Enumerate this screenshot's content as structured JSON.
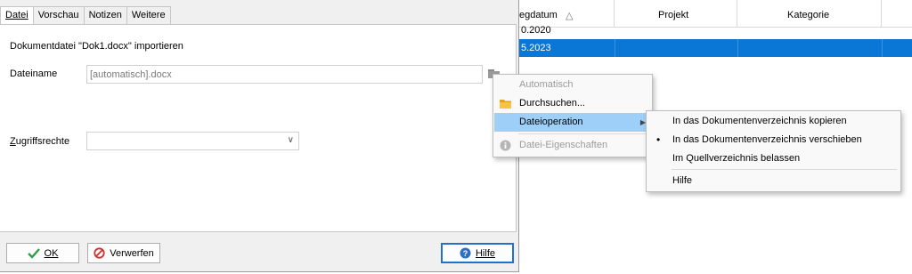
{
  "background_list": {
    "columns": [
      "egdatum",
      "Projekt",
      "Kategorie"
    ],
    "sort_indicator": "△",
    "rows": [
      {
        "date": "0.2020",
        "selected": false
      },
      {
        "date": "5.2023",
        "selected": true
      }
    ]
  },
  "dialog": {
    "tabs": [
      {
        "label": "Datei",
        "active": true
      },
      {
        "label": "Vorschau",
        "active": false
      },
      {
        "label": "Notizen",
        "active": false
      },
      {
        "label": "Weitere",
        "active": false
      }
    ],
    "heading": "Dokumentdatei \"Dok1.docx\" importieren",
    "filename_label": "Dateiname",
    "filename_value": "[automatisch].docx",
    "access_label": "Zugriffsrechte",
    "access_value": "",
    "buttons": {
      "ok": "OK",
      "discard": "Verwerfen",
      "help": "Hilfe"
    }
  },
  "context_menu": {
    "items": [
      {
        "label": "Automatisch",
        "disabled": true
      },
      {
        "label": "Durchsuchen...",
        "icon": "folder-icon"
      },
      {
        "label": "Dateioperation",
        "highlighted": true,
        "has_submenu": true
      },
      {
        "label": "Datei-Eigenschaften",
        "disabled": true,
        "icon": "info-icon"
      }
    ]
  },
  "submenu": {
    "items": [
      {
        "label": "In das Dokumentenverzeichnis kopieren",
        "checked": false
      },
      {
        "label": "In das Dokumentenverzeichnis verschieben",
        "checked": true
      },
      {
        "label": "Im Quellverzeichnis belassen",
        "checked": false
      },
      {
        "label": "Hilfe",
        "checked": false
      }
    ],
    "bullet": "•"
  },
  "colors": {
    "selection_blue": "#0a76d6",
    "menu_highlight": "#9ecff8",
    "default_button_border": "#2470c9"
  }
}
